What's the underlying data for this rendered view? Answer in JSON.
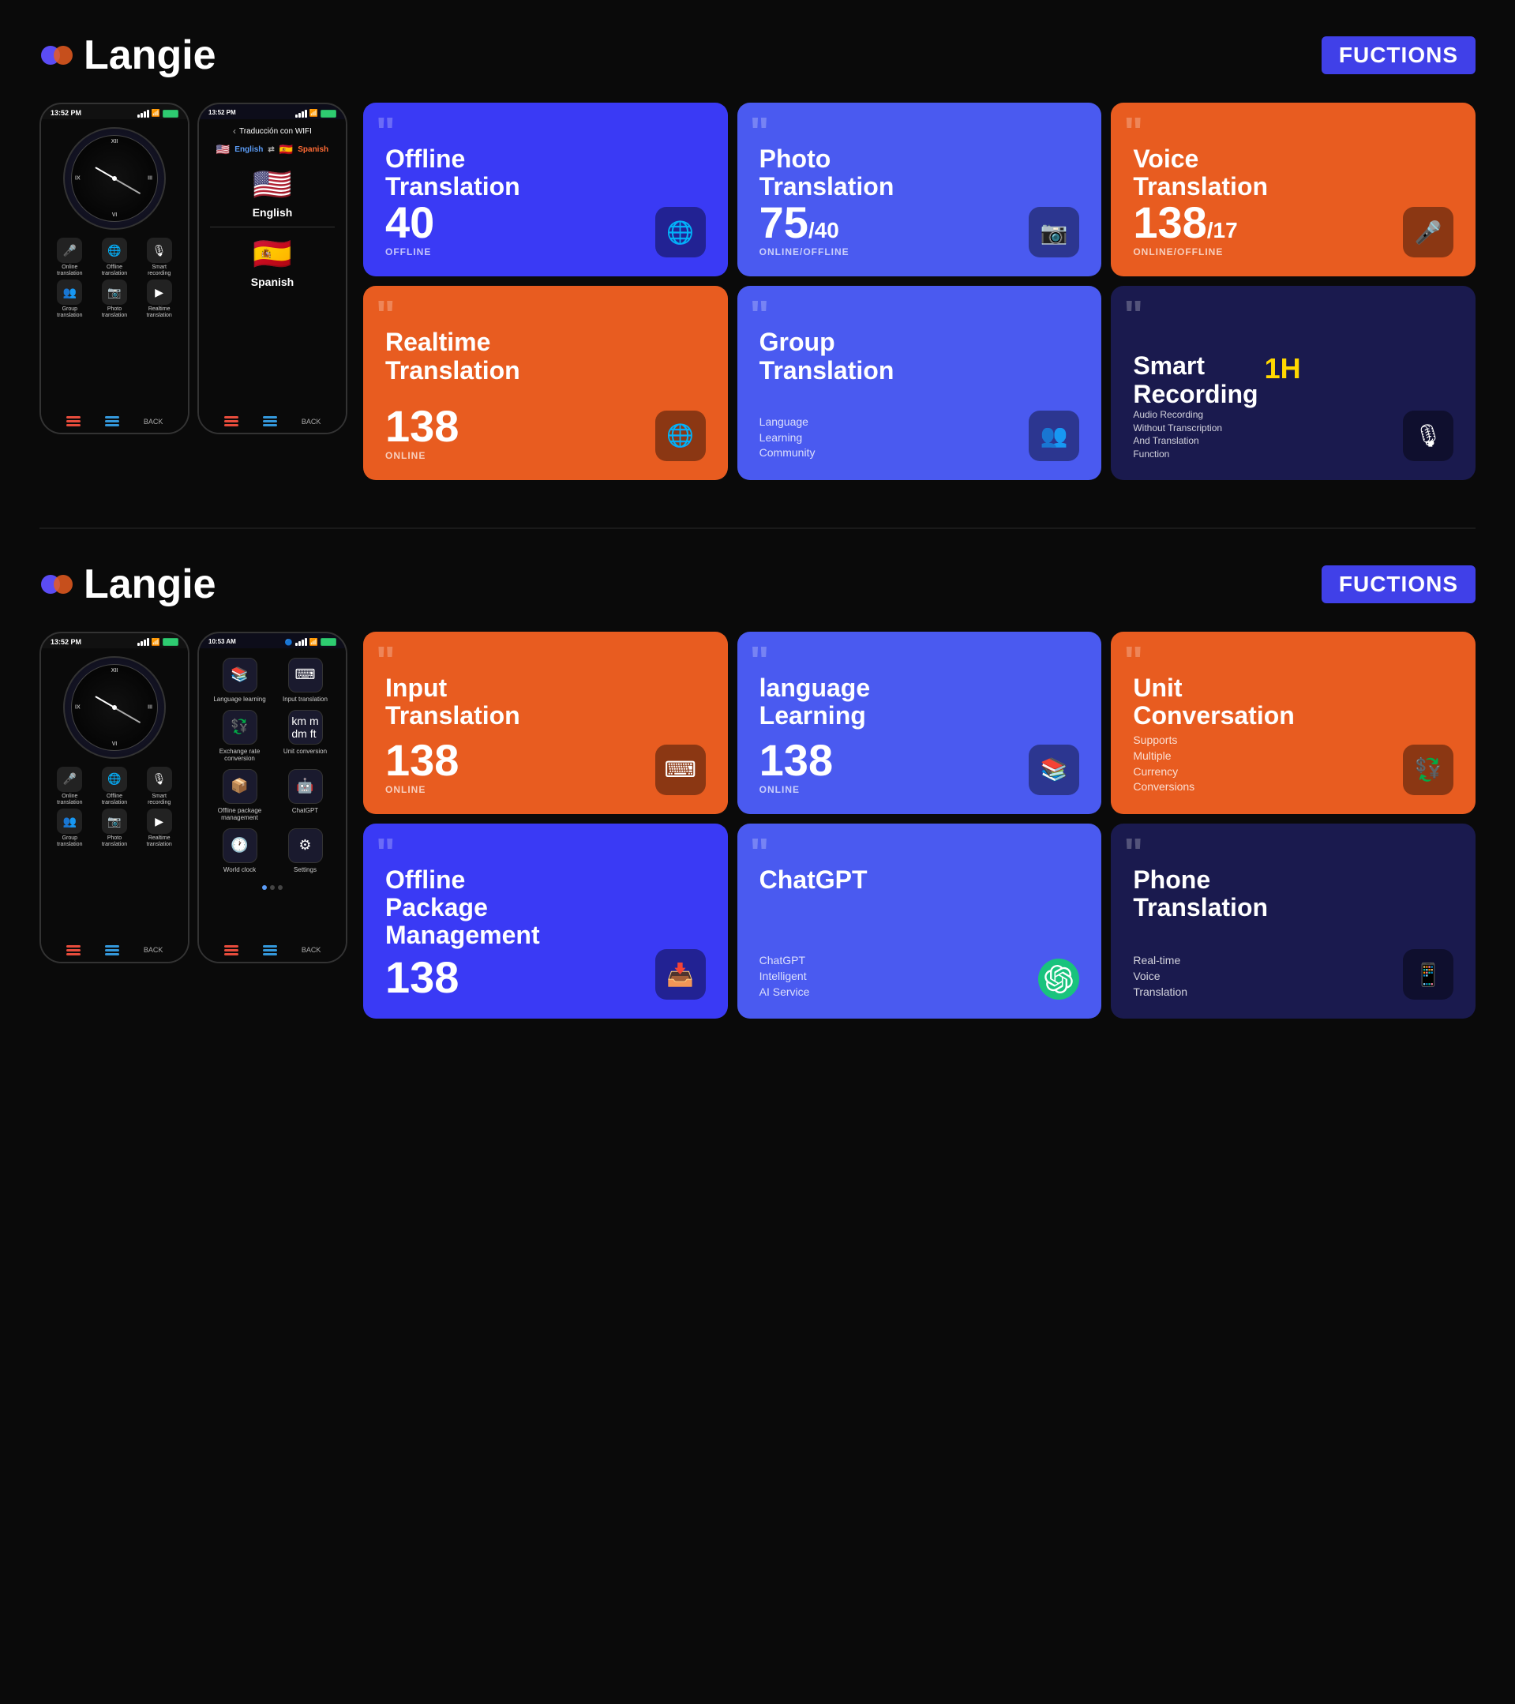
{
  "section1": {
    "logo": {
      "text": "Langie",
      "icon": "💜"
    },
    "badge": "FUCTIONS",
    "phone1": {
      "time": "13:52 PM",
      "apps": [
        {
          "icon": "🎤",
          "label": "Online\ntranslation"
        },
        {
          "icon": "🌐",
          "label": "Offline\ntranslation"
        },
        {
          "icon": "🎙",
          "label": "Smart\nrecording"
        },
        {
          "icon": "👥",
          "label": "Group\ntranslation"
        },
        {
          "icon": "📷",
          "label": "Photo\ntranslation"
        },
        {
          "icon": "▶",
          "label": "Realtime\ntranslation"
        }
      ]
    },
    "phone2": {
      "header": "Traducción con WIFI",
      "lang_from": "English",
      "lang_from_flag": "🇺🇸",
      "lang_to": "Spanish",
      "lang_to_flag": "🇪🇸"
    },
    "cards": [
      {
        "id": "offline-translation",
        "title": "Offline\nTranslation",
        "count": "40",
        "count_suffix": "",
        "status": "OFFLINE",
        "color": "blue",
        "icon": "🌐"
      },
      {
        "id": "photo-translation",
        "title": "Photo\nTranslation",
        "count": "75",
        "count_suffix": "/40",
        "status": "ONLINE/OFFLINE",
        "color": "blue2",
        "icon": "📷"
      },
      {
        "id": "voice-translation",
        "title": "Voice\nTranslation",
        "count": "138",
        "count_suffix": "/17",
        "status": "ONLINE/OFFLINE",
        "color": "orange",
        "icon": "🎤"
      },
      {
        "id": "realtime-translation",
        "title": "Realtime\nTranslation",
        "count": "138",
        "count_suffix": "",
        "status": "ONLINE",
        "color": "orange",
        "icon": "🌐"
      },
      {
        "id": "group-translation",
        "title": "Group\nTranslation",
        "subtitle": "Language\nLearning\nCommunity",
        "count": "",
        "status": "",
        "color": "blue2",
        "icon": "👥"
      },
      {
        "id": "smart-recording",
        "title": "Smart\nRecording",
        "badge": "1H",
        "desc": "Audio Recording Without Transcription And Translation Function",
        "color": "dark-blue",
        "icon": "🎙"
      }
    ]
  },
  "section2": {
    "logo": {
      "text": "Langie",
      "icon": "💜"
    },
    "badge": "FUCTIONS",
    "phone1": {
      "time": "13:52 PM"
    },
    "phone2": {
      "time": "10:53 AM",
      "menu_items": [
        {
          "icon": "📚",
          "label": "Language learning"
        },
        {
          "icon": "⌨",
          "label": "Input translation"
        },
        {
          "icon": "💱",
          "label": "Exchange rate conversion"
        },
        {
          "icon": "📏",
          "label": "Unit conversion"
        },
        {
          "icon": "📦",
          "label": "Offline package management"
        },
        {
          "icon": "🤖",
          "label": "ChatGPT"
        },
        {
          "icon": "🕐",
          "label": "World clock"
        },
        {
          "icon": "⚙",
          "label": "Settings"
        }
      ]
    },
    "cards": [
      {
        "id": "input-translation",
        "title": "Input\nTranslation",
        "count": "138",
        "status": "ONLINE",
        "color": "orange",
        "icon": "⌨"
      },
      {
        "id": "language-learning",
        "title": "language\nLearning",
        "count": "138",
        "status": "ONLINE",
        "color": "blue2",
        "icon": "📚"
      },
      {
        "id": "unit-conversation",
        "title": "Unit\nConversation",
        "subtitle": "Supports\nMultiple\nCurrency\nConversions",
        "color": "orange",
        "icon": "💱"
      },
      {
        "id": "offline-package",
        "title": "Offline\nPackage\nManagement",
        "count": "138",
        "status": "",
        "color": "blue",
        "icon": "📥"
      },
      {
        "id": "chatgpt",
        "title": "ChatGPT",
        "subtitle": "ChatGPT\nIntelligent\nAI Service",
        "color": "blue2",
        "icon": "🤖"
      },
      {
        "id": "phone-translation",
        "title": "Phone\nTranslation",
        "subtitle": "Real-time\nVoice\nTranslation",
        "color": "dark-blue",
        "icon": "📱"
      }
    ]
  }
}
